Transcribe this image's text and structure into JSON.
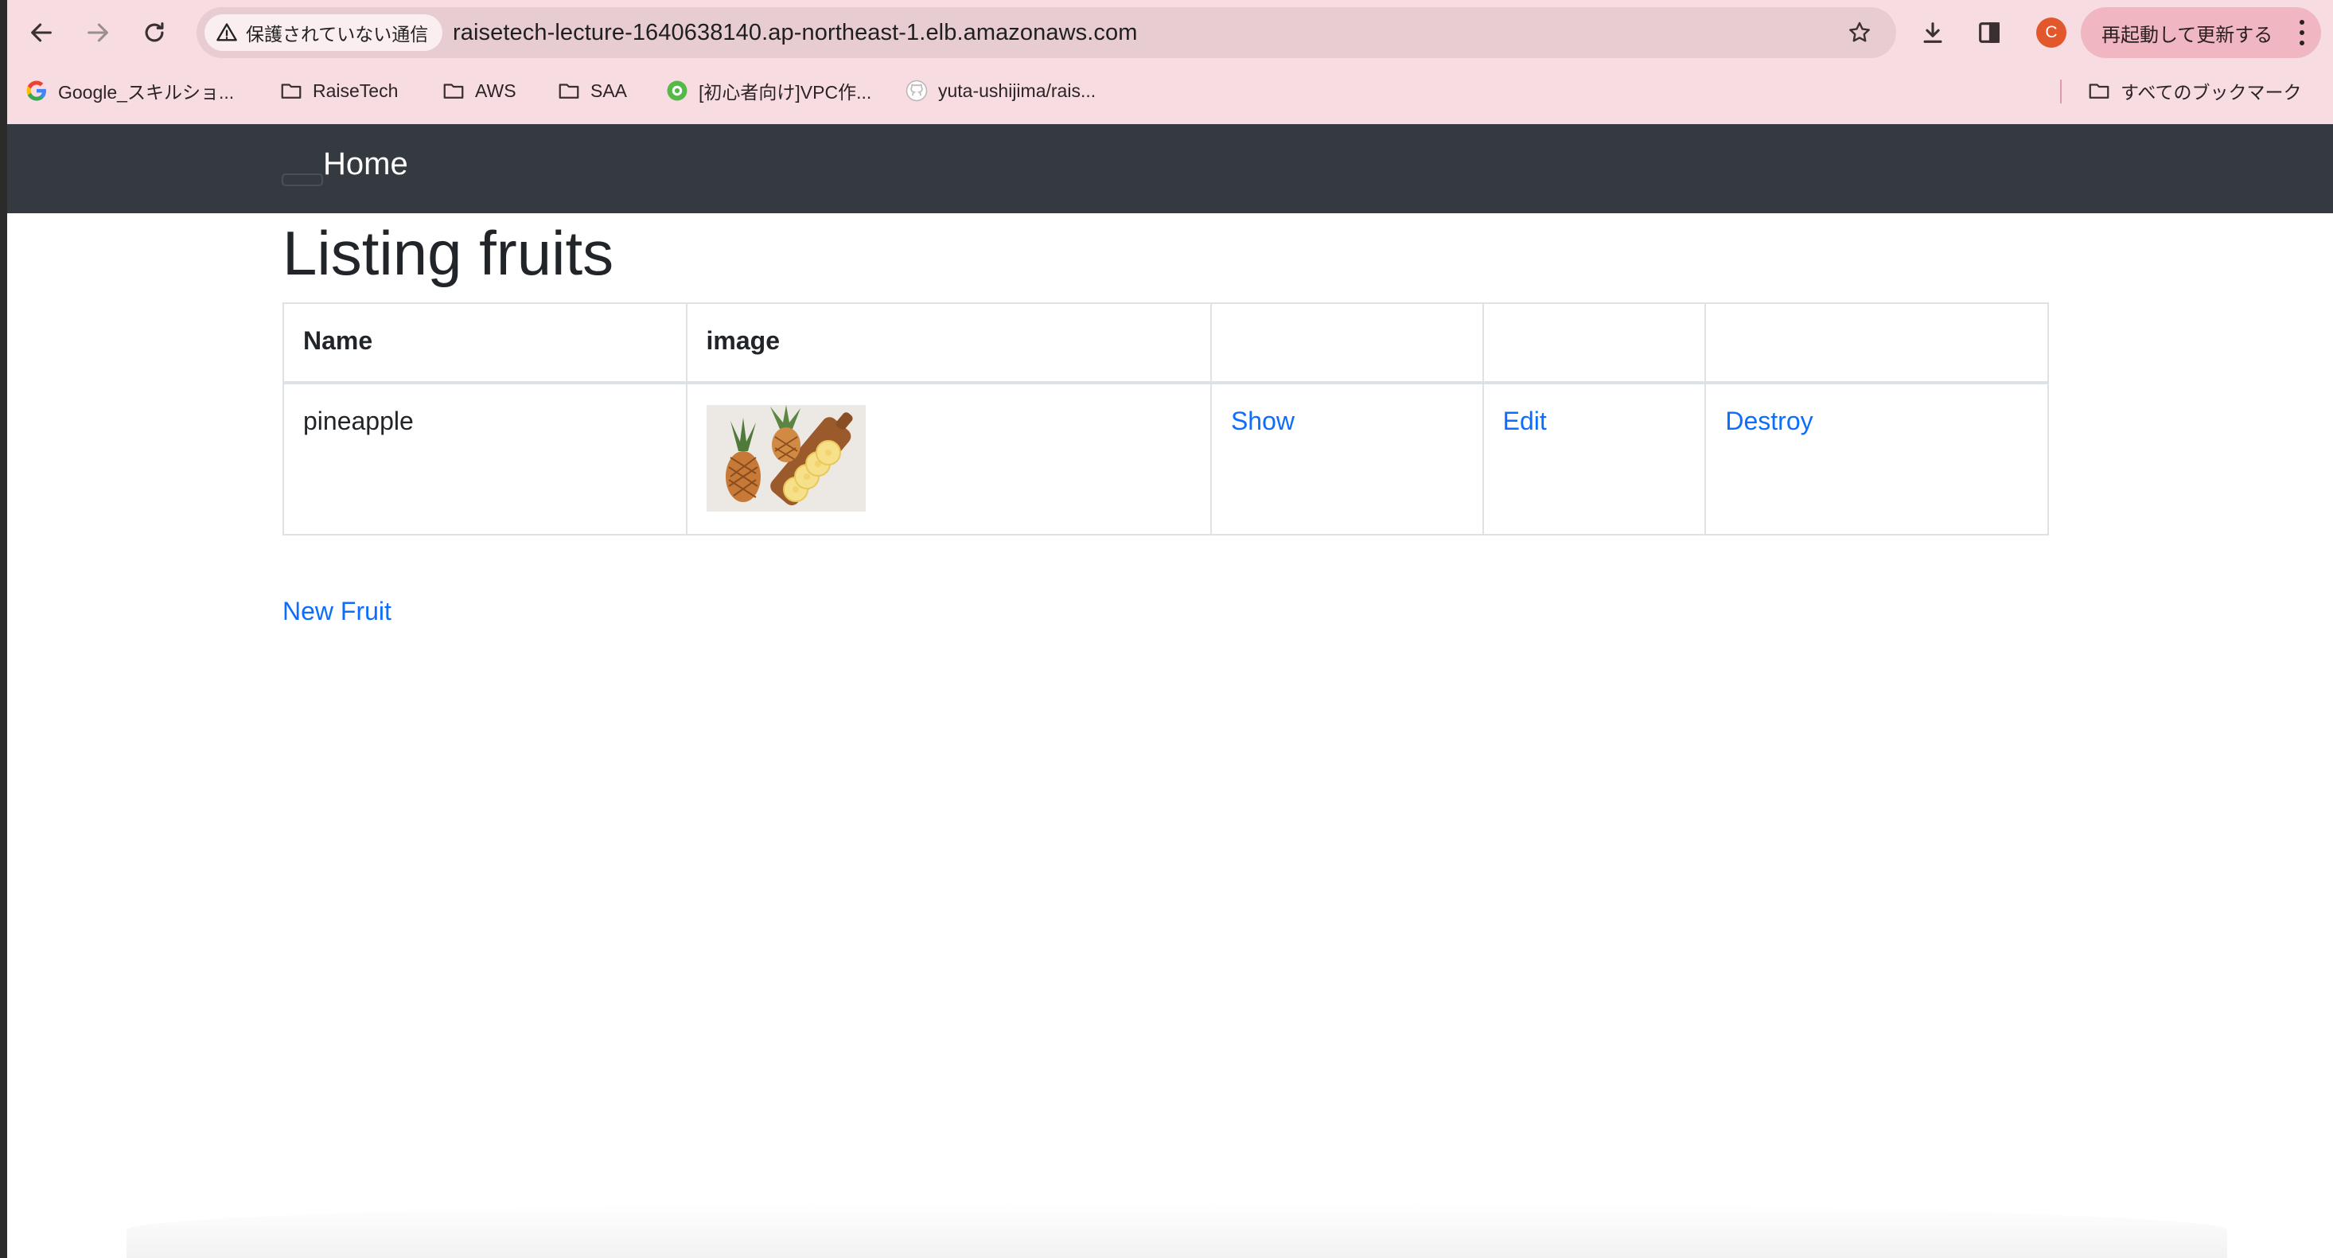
{
  "browser": {
    "security_label": "保護されていない通信",
    "url": "raisetech-lecture-1640638140.ap-northeast-1.elb.amazonaws.com",
    "profile_initial": "C",
    "update_label": "再起動して更新する"
  },
  "bookmarks": {
    "items": [
      {
        "label": "Google_スキルショ...",
        "icon": "google-icon"
      },
      {
        "label": "RaiseTech",
        "icon": "folder-icon"
      },
      {
        "label": "AWS",
        "icon": "folder-icon"
      },
      {
        "label": "SAA",
        "icon": "folder-icon"
      },
      {
        "label": "[初心者向け]VPC作...",
        "icon": "site-icon"
      },
      {
        "label": "yuta-ushijima/rais...",
        "icon": "github-icon"
      }
    ],
    "all_bookmarks_label": "すべてのブックマーク"
  },
  "navbar": {
    "brand": "Home"
  },
  "main": {
    "title": "Listing fruits",
    "table": {
      "headers": [
        "Name",
        "image",
        "",
        "",
        ""
      ],
      "rows": [
        {
          "name": "pineapple",
          "image_alt": "pineapple",
          "show": "Show",
          "edit": "Edit",
          "destroy": "Destroy"
        }
      ]
    },
    "new_link": "New Fruit"
  },
  "colors": {
    "navbar_bg": "#343a40",
    "link": "#0d6efd",
    "chrome_bg": "#f7dde2",
    "update_button": "#f0b7c2",
    "avatar": "#e2572c"
  }
}
